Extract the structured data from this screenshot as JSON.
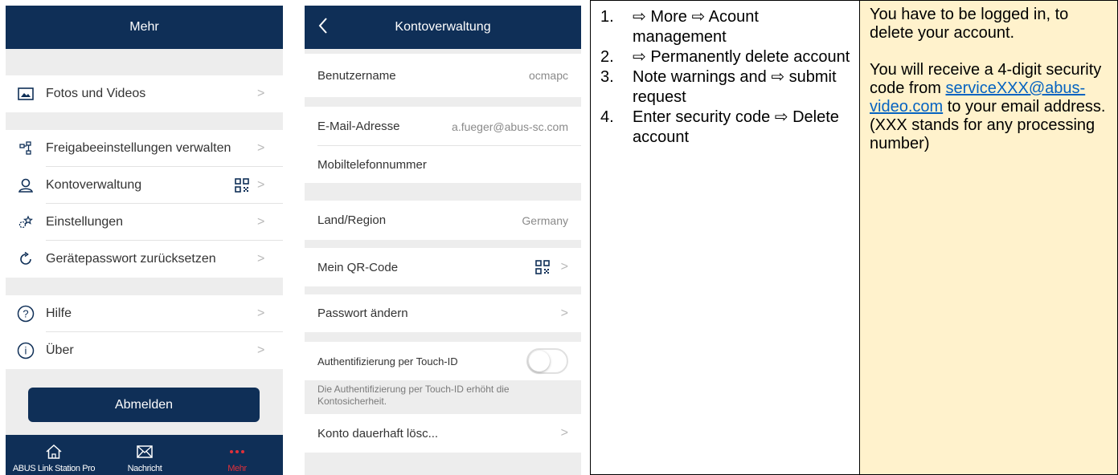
{
  "screen_more": {
    "title": "Mehr",
    "items": [
      {
        "label": "Fotos und Videos",
        "icon": "photo-icon"
      },
      {
        "label": "Freigabeeinstellungen verwalten",
        "icon": "share-settings-icon"
      },
      {
        "label": "Kontoverwaltung",
        "icon": "user-icon",
        "extra_icon": "qr-code-icon"
      },
      {
        "label": "Einstellungen",
        "icon": "settings-icon"
      },
      {
        "label": "Gerätepasswort zurücksetzen",
        "icon": "reset-icon"
      },
      {
        "label": "Hilfe",
        "icon": "help-icon"
      },
      {
        "label": "Über",
        "icon": "info-icon"
      }
    ],
    "logout_label": "Abmelden",
    "tabs": [
      {
        "label": "ABUS Link Station Pro",
        "icon": "home-icon"
      },
      {
        "label": "Nachricht",
        "icon": "mail-icon"
      },
      {
        "label": "Mehr",
        "icon": "more-icon"
      }
    ],
    "active_tab_color": "#e0303a",
    "brand_color": "#0f2f57"
  },
  "screen_account": {
    "title": "Kontoverwaltung",
    "username_label": "Benutzername",
    "username_value": "ocmapc",
    "email_label": "E-Mail-Adresse",
    "email_value": "a.fueger@abus-sc.com",
    "mobile_label": "Mobiltelefonnummer",
    "region_label": "Land/Region",
    "region_value": "Germany",
    "qr_label": "Mein QR-Code",
    "password_label": "Passwort ändern",
    "touchid_label": "Authentifizierung per Touch-ID",
    "touchid_enabled": false,
    "touchid_note": "Die Authentifizierung per Touch-ID erhöht die Kontosicherheit.",
    "delete_label": "Konto dauerhaft lösc..."
  },
  "steps": [
    {
      "num": "1.",
      "text": "⇨ More ⇨ Acount management"
    },
    {
      "num": "2.",
      "text": "⇨ Permanently delete account"
    },
    {
      "num": "3.",
      "text": "Note warnings and ⇨ submit request"
    },
    {
      "num": "4.",
      "text": "Enter security code ⇨ Delete account"
    }
  ],
  "info": {
    "line1": "You have to be logged in, to delete your account.",
    "line2_pre": "You will receive a 4-digit security code from ",
    "link": "serviceXXX@abus-video.com",
    "line2_post": " to your email address.",
    "line3": "(XXX stands for any processing number)"
  }
}
